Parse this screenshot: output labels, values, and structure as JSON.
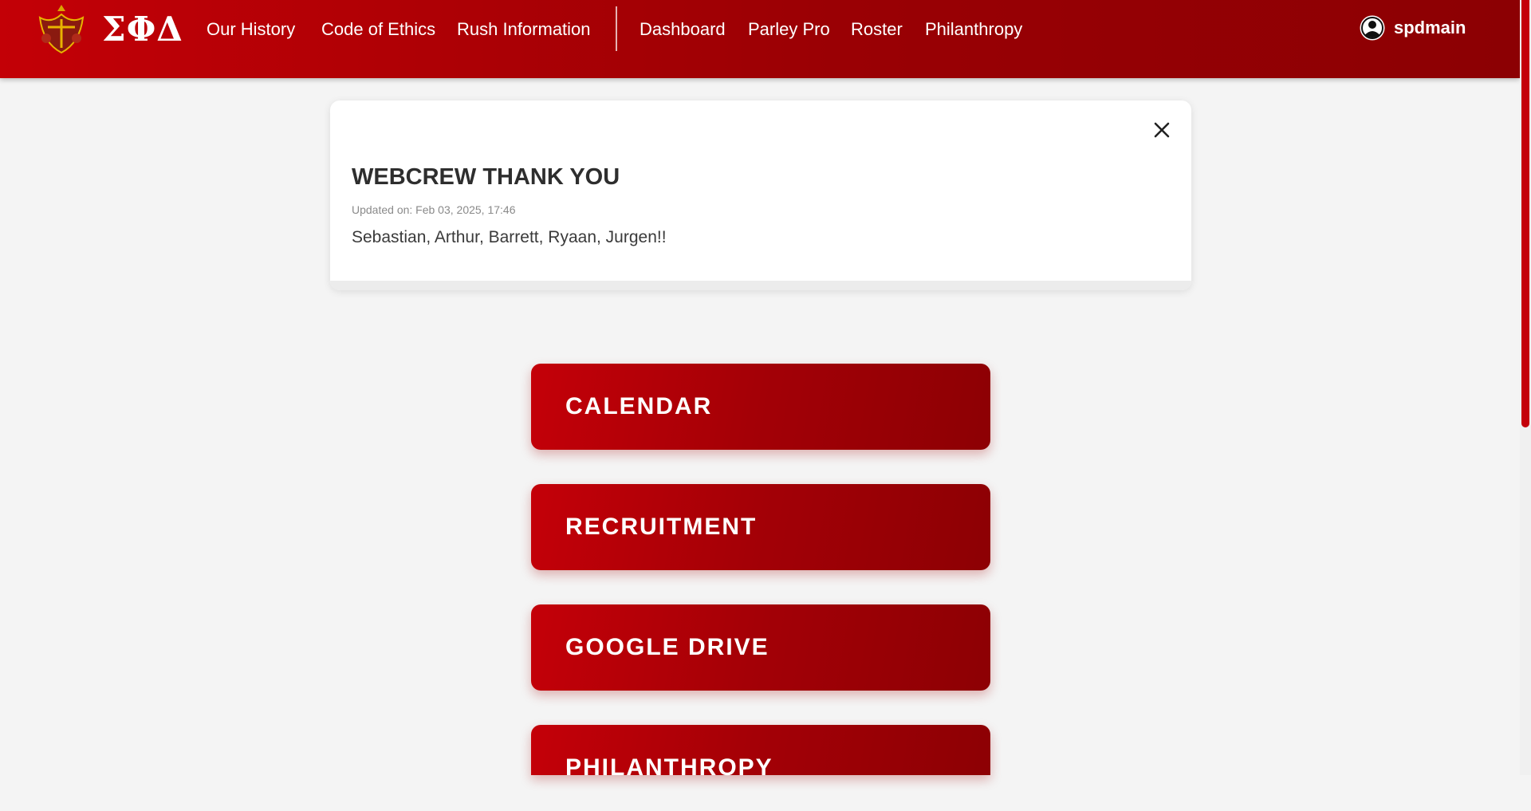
{
  "brand": {
    "letters": "ΣΦΔ"
  },
  "nav": {
    "links": [
      "Our History",
      "Code of Ethics",
      "Rush Information",
      "Dashboard",
      "Parley Pro",
      "Roster",
      "Philanthropy"
    ],
    "user": "spdmain"
  },
  "announcement": {
    "title": "WEBCREW THANK YOU",
    "updated": "Updated on: Feb 03, 2025, 17:46",
    "body": "Sebastian, Arthur, Barrett, Ryaan, Jurgen!!"
  },
  "tiles": [
    "CALENDAR",
    "RECRUITMENT",
    "GOOGLE DRIVE",
    "PHILANTHROPY"
  ],
  "colors": {
    "primary": "#c30006",
    "dark": "#8c0003"
  }
}
